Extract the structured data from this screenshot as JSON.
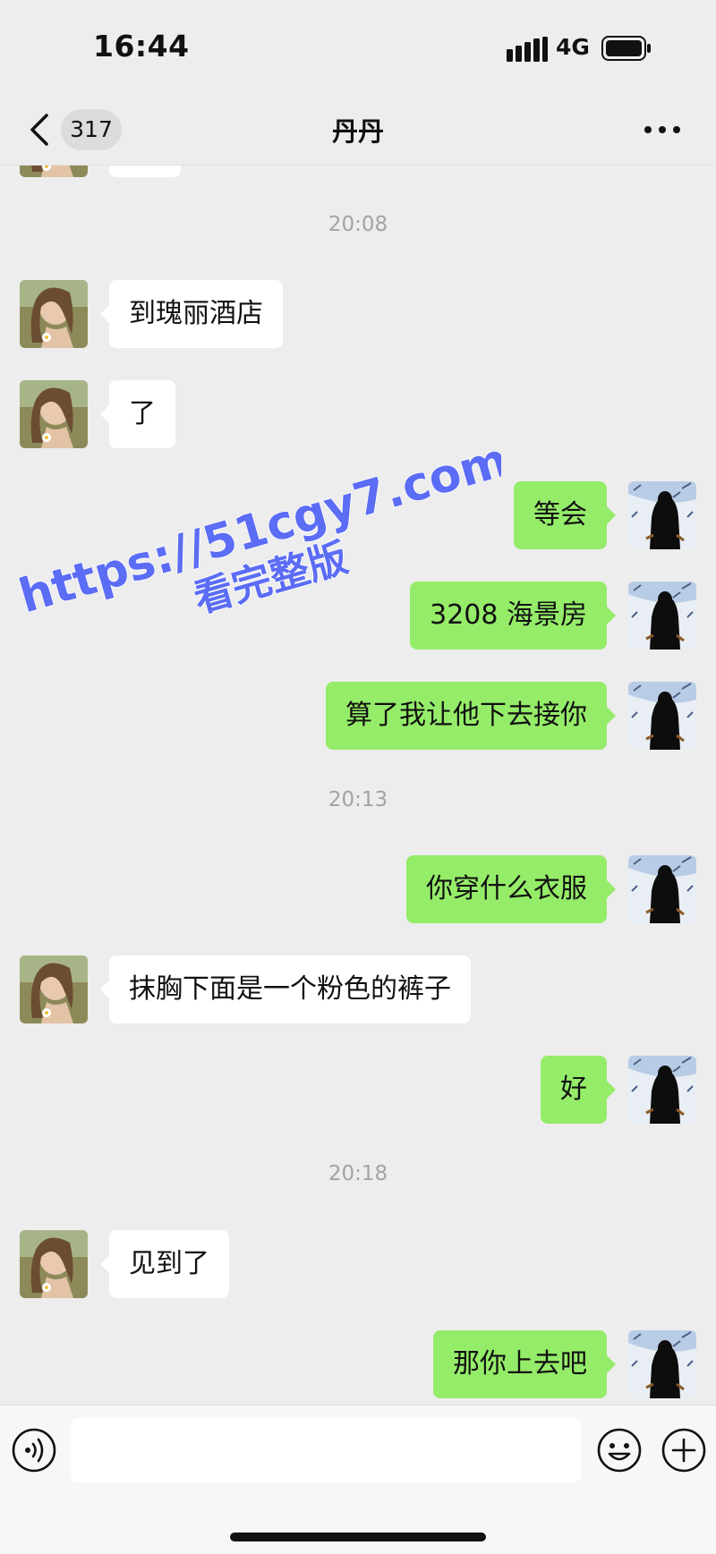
{
  "status_bar": {
    "time": "16:44",
    "network": "4G",
    "signal_icon": "signal-bars-icon",
    "battery_icon": "battery-icon"
  },
  "nav": {
    "unread_count": "317",
    "title": "丹丹",
    "back_icon": "chevron-left-icon",
    "more_icon": "more-dots-icon"
  },
  "messages": {
    "ts_1": "20:08",
    "msg_1": "到瑰丽酒店",
    "msg_2": "了",
    "msg_3": "等会",
    "msg_4": "3208 海景房",
    "msg_5": "算了我让他下去接你",
    "ts_2": "20:13",
    "msg_6": "你穿什么衣服",
    "msg_7": "抹胸下面是一个粉色的裤子",
    "msg_8": "好",
    "ts_3": "20:18",
    "msg_9": "见到了",
    "msg_10": "那你上去吧"
  },
  "watermark": {
    "line1": "https://51cgy7.com",
    "line2": "看完整版"
  },
  "input_bar": {
    "value": "",
    "placeholder": "",
    "voice_icon": "voice-icon",
    "emoji_icon": "emoji-icon",
    "plus_icon": "plus-icon"
  },
  "colors": {
    "background": "#ededed",
    "outgoing_bubble": "#95ec69",
    "incoming_bubble": "#ffffff",
    "watermark": "#5b6cf5",
    "timestamp": "#a3a3a3"
  }
}
